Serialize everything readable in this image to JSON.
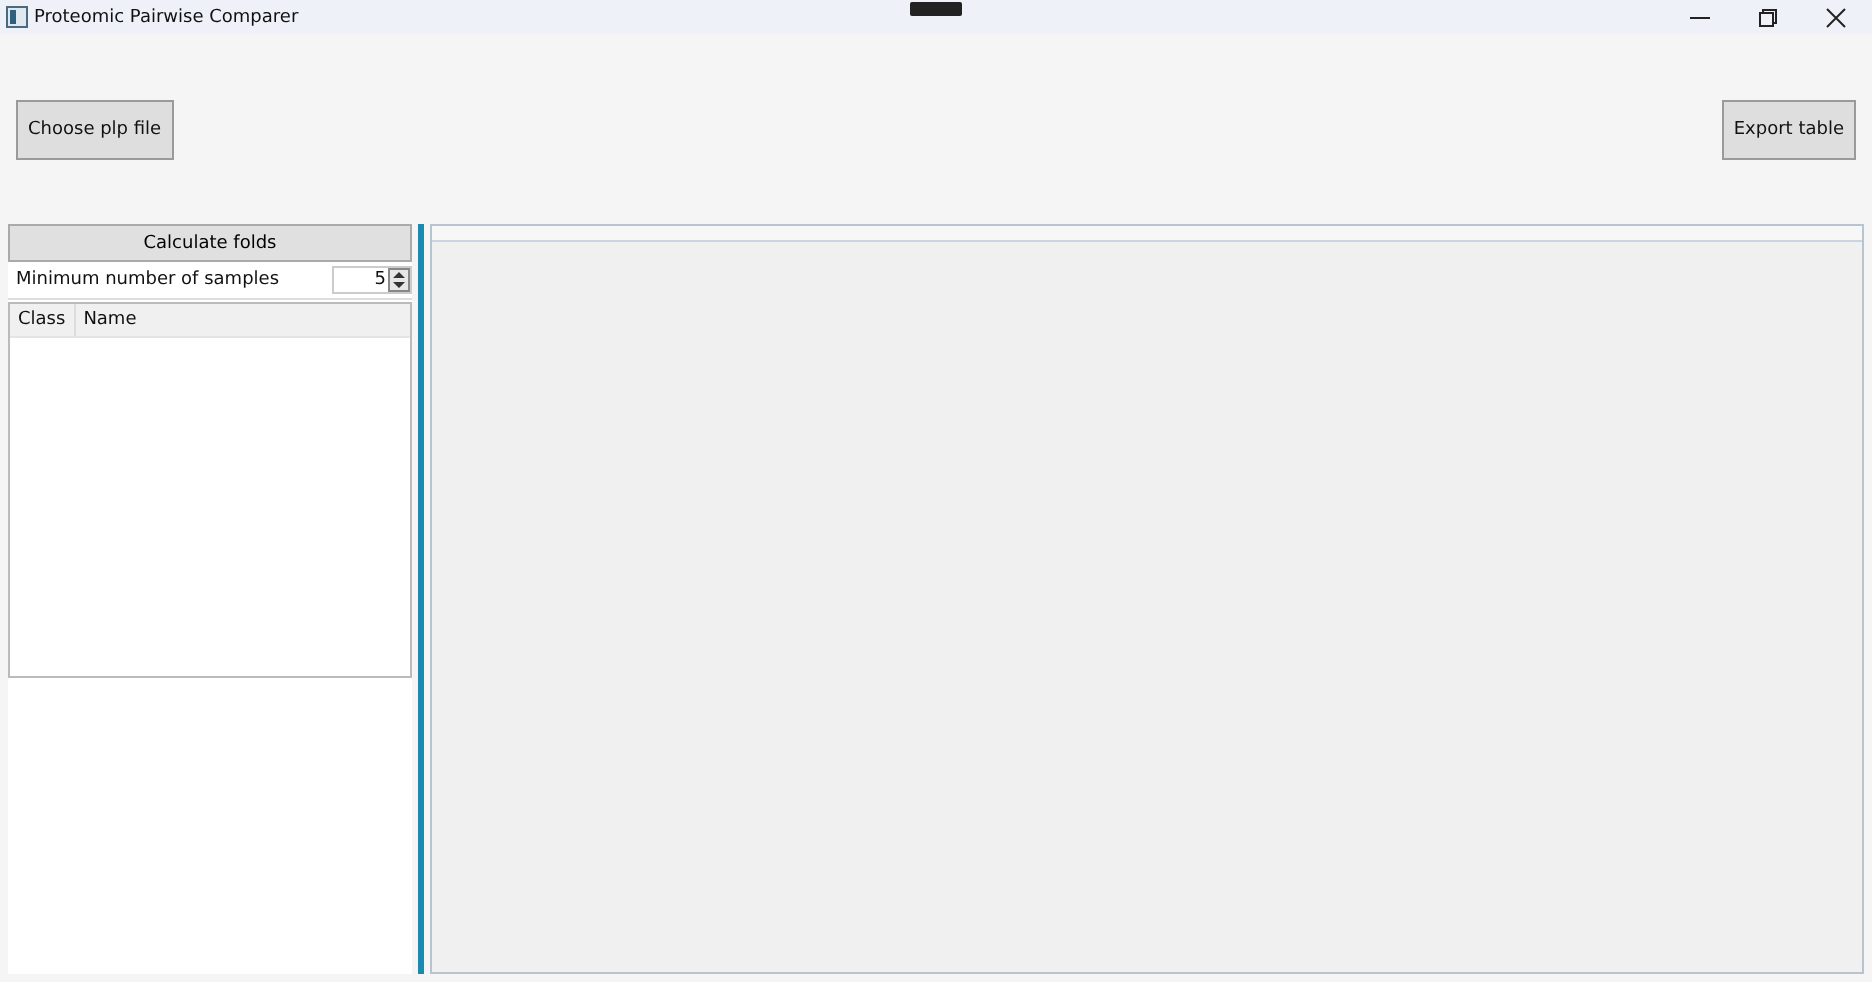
{
  "window": {
    "title": "Proteomic Pairwise Comparer"
  },
  "toolbar": {
    "left_button": "Choose plp file",
    "right_button": "Export table"
  },
  "side_panel": {
    "button": "Calculate folds",
    "min_samples": {
      "label": "Minimum number of samples",
      "value": "5"
    },
    "table": {
      "columns": [
        "Class",
        "Name"
      ]
    }
  }
}
